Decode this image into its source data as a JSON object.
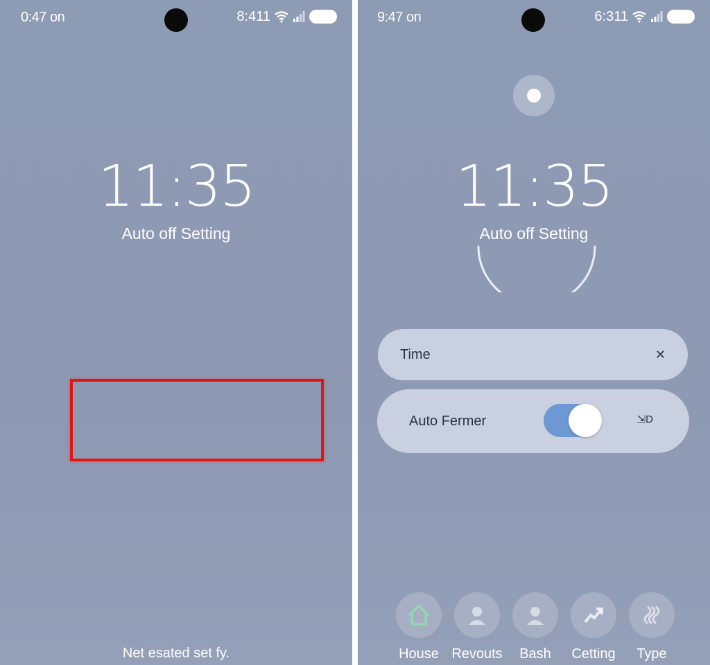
{
  "left_screen": {
    "status": {
      "time": "0:47 on",
      "right": "8:411"
    },
    "clock": "11:35",
    "subtitle": "Auto off Setting",
    "footer": "Net esated set fy.",
    "highlight_color": "#e3130f"
  },
  "right_screen": {
    "status": {
      "time": "9:47 on",
      "right": "6:311"
    },
    "clock": "11:35",
    "subtitle": "Auto off Setting",
    "time_row": {
      "label": "Time",
      "action": "✕"
    },
    "auto_row": {
      "label": "Auto Fermer",
      "toggle_on": true,
      "trailing": "⇲D"
    },
    "nav": [
      {
        "label": "House",
        "icon": "house-icon"
      },
      {
        "label": "Revouts",
        "icon": "person-icon"
      },
      {
        "label": "Bash",
        "icon": "person-icon"
      },
      {
        "label": "Cetting",
        "icon": "trend-arrow-icon"
      },
      {
        "label": "Type",
        "icon": "wave-icon"
      }
    ],
    "colors": {
      "toggle": "#6e98d4",
      "card": "#c9d0e0",
      "house_icon": "#8fdcb0"
    }
  }
}
